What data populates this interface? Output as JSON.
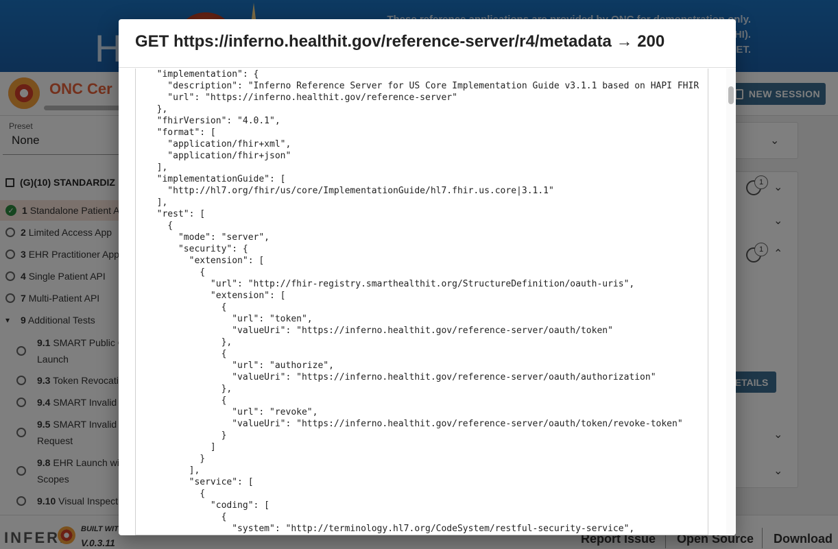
{
  "banner": {
    "logo_text": "H",
    "notice_lines": [
      "These reference applications are provided by ONC for demonstration only.",
      "HI).",
      "ET."
    ]
  },
  "appbar": {
    "title": "ONC Cer",
    "new_session_label": "NEW SESSION"
  },
  "sidebar": {
    "preset_label": "Preset",
    "preset_value": "None",
    "suite_title": "(G)(10) STANDARDIZ",
    "items": [
      {
        "num": "1",
        "label": "Standalone Patient A",
        "status": "passed"
      },
      {
        "num": "2",
        "label": "Limited Access App",
        "status": "none"
      },
      {
        "num": "3",
        "label": "EHR Practitioner App",
        "status": "none"
      },
      {
        "num": "4",
        "label": "Single Patient API",
        "status": "none"
      },
      {
        "num": "7",
        "label": "Multi-Patient API",
        "status": "none"
      },
      {
        "num": "9",
        "label": "Additional Tests",
        "status": "expanded"
      }
    ],
    "sub_items": [
      {
        "num": "9.1",
        "label": "SMART Public C",
        "label2": "Launch"
      },
      {
        "num": "9.3",
        "label": "Token Revocatio"
      },
      {
        "num": "9.4",
        "label": "SMART Invalid A"
      },
      {
        "num": "9.5",
        "label": "SMART Invalid T",
        "label2": "Request"
      },
      {
        "num": "9.8",
        "label": "EHR Launch wit",
        "label2": "Scopes"
      },
      {
        "num": "9.10",
        "label": "Visual Inspecti"
      }
    ]
  },
  "main": {
    "badge_count_1": "1",
    "badge_count_2": "1",
    "details_label": "ETAILS"
  },
  "footer": {
    "logo": "INFERN",
    "built_with": "BUILT WIT",
    "version": "V.0.3.11",
    "report_issue": "Report Issue",
    "open_source": "Open Source",
    "download": "Download"
  },
  "modal": {
    "title": "GET https://inferno.healthit.gov/reference-server/r4/metadata → 200",
    "body_lines": [
      "  \"implementation\": {",
      "    \"description\": \"Inferno Reference Server for US Core Implementation Guide v3.1.1 based on HAPI FHIR",
      "    \"url\": \"https://inferno.healthit.gov/reference-server\"",
      "  },",
      "  \"fhirVersion\": \"4.0.1\",",
      "  \"format\": [",
      "    \"application/fhir+xml\",",
      "    \"application/fhir+json\"",
      "  ],",
      "  \"implementationGuide\": [",
      "    \"http://hl7.org/fhir/us/core/ImplementationGuide/hl7.fhir.us.core|3.1.1\"",
      "  ],",
      "  \"rest\": [",
      "    {",
      "      \"mode\": \"server\",",
      "      \"security\": {",
      "        \"extension\": [",
      "          {",
      "            \"url\": \"http://fhir-registry.smarthealthit.org/StructureDefinition/oauth-uris\",",
      "            \"extension\": [",
      "              {",
      "                \"url\": \"token\",",
      "                \"valueUri\": \"https://inferno.healthit.gov/reference-server/oauth/token\"",
      "              },",
      "              {",
      "                \"url\": \"authorize\",",
      "                \"valueUri\": \"https://inferno.healthit.gov/reference-server/oauth/authorization\"",
      "              },",
      "              {",
      "                \"url\": \"revoke\",",
      "                \"valueUri\": \"https://inferno.healthit.gov/reference-server/oauth/token/revoke-token\"",
      "              }",
      "            ]",
      "          }",
      "        ],",
      "        \"service\": [",
      "          {",
      "            \"coding\": [",
      "              {",
      "                \"system\": \"http://terminology.hl7.org/CodeSystem/restful-security-service\","
    ]
  }
}
